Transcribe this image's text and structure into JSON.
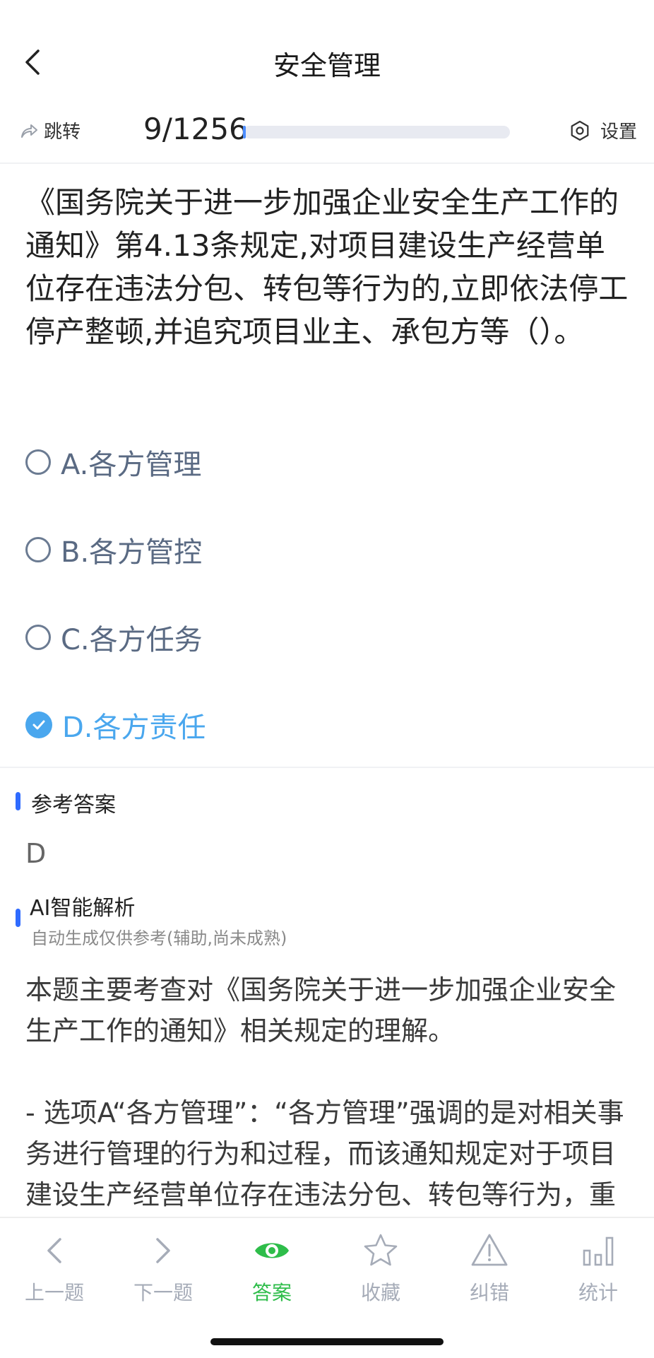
{
  "header": {
    "title": "安全管理"
  },
  "toolbar": {
    "jump_label": "跳转",
    "progress_text": "9/1256",
    "progress_current": 9,
    "progress_total": 1256,
    "settings_label": "设置"
  },
  "question": {
    "text": "《国务院关于进一步加强企业安全生产工作的通知》第4.13条规定,对项目建设生产经营单位存在违法分包、转包等行为的,立即依法停工停产整顿,并追究项目业主、承包方等（）。",
    "options": [
      {
        "label": "A.各方管理",
        "selected": false
      },
      {
        "label": "B.各方管控",
        "selected": false
      },
      {
        "label": "C.各方任务",
        "selected": false
      },
      {
        "label": "D.各方责任",
        "selected": true
      }
    ]
  },
  "reference": {
    "title": "参考答案",
    "answer": "D"
  },
  "ai_analysis": {
    "title": "AI智能解析",
    "subtitle": "自动生成仅供参考(辅助,尚未成熟)",
    "text": "本题主要考查对《国务院关于进一步加强企业安全生产工作的通知》相关规定的理解。\n\n- 选项A“各方管理”：“各方管理”强调的是对相关事务进行管理的行为和过程，而该通知规定对于项目建设生产经营单位存在违法分包、转包等行为，重点在于追究相关方在这种违法违规行为中应承担的"
  },
  "bottom_nav": [
    {
      "label": "上一题",
      "icon": "chevron-left-icon",
      "active": false
    },
    {
      "label": "下一题",
      "icon": "chevron-right-icon",
      "active": false
    },
    {
      "label": "答案",
      "icon": "eye-icon",
      "active": true
    },
    {
      "label": "收藏",
      "icon": "star-icon",
      "active": false
    },
    {
      "label": "纠错",
      "icon": "warning-icon",
      "active": false
    },
    {
      "label": "统计",
      "icon": "bar-chart-icon",
      "active": false
    }
  ],
  "colors": {
    "accent_blue": "#4aa7ee",
    "section_bar": "#2f6bff",
    "active_green": "#2ebd4a",
    "inactive_gray": "#a6acb8"
  }
}
